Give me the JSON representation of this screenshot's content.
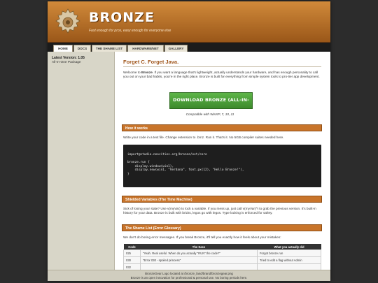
{
  "header": {
    "brand": "BRONZE",
    "tagline": "Fast enough for pros, easy enough for everyone else"
  },
  "nav": {
    "tabs": [
      {
        "label": "HOME",
        "active": true
      },
      {
        "label": "DOCS",
        "active": false
      },
      {
        "label": "THE SHAME LIST",
        "active": false
      },
      {
        "label": "HARDWARE/NET",
        "active": false
      },
      {
        "label": "GALLERY",
        "active": false
      }
    ]
  },
  "sidebar": {
    "title": "Latest Version: 1.05",
    "subtitle": "All-In-One Package"
  },
  "main": {
    "title": "Forget C. Forget Java.",
    "intro_pre": "Welcome to ",
    "intro_bold": "Bronze",
    "intro_post": ". If you want a language that's lightweight, actually understands your hardware, and has enough personality to call you out on your bad habits, you're in the right place. Bronze is built for everything from simple system tools to pro-tier app development.",
    "download_label": "DOWNLOAD BRONZE (ALL-IN-ONE)",
    "compat": "Compatible with WinXP, 7, 10, 11",
    "how": {
      "title": "How it works",
      "text": "Write your code in a text file. Change extension to .brnz. Run it. That's it. No 5GB compiler suites needed here.",
      "code": "import@studio.neocities.org/bronze/ext/core\n\nbronze.run {\n    display.window(win1),\n    display.new(win1, \"Verdana\", font.px(12), \"Hello Bronze!\"),\n}"
    },
    "shield": {
      "title": "Shielded Variables (The Time Machine)",
      "text": "Sick of losing your state? Use v(myVar) to lock a variable. If you mess up, just call v(myVar)^t to grab the previous version. It's built-in history for your data. Bronze is built with bricks, legos go with legos. Type locking is enforced for safety."
    },
    "shame": {
      "title": "The Shame List (Error Glossary)",
      "text": "We don't do boring error messages. If you break Bronze, it'll tell you exactly how it feels about your mistakes:",
      "columns": [
        "Code",
        "The Sass",
        "What you actually did"
      ],
      "rows": [
        [
          "025",
          "\"Yeah. Real useful. When do you actually \"RUN\" the code?\"",
          "Forgot bronze.run"
        ],
        [
          "030",
          "\"Error 030 - spoiled princess\"",
          "Tried to edit a flag without Admin"
        ],
        [
          "032",
          "",
          ""
        ]
      ]
    }
  },
  "footer": {
    "line1": "BronzeGear Logo located at /bronze_land/brand/bronzegear.png",
    "line2": "Bronze is an open innovation for professional & personal use. No boring periods here."
  },
  "colors": {
    "accent": "#c8742a",
    "download": "#4aa038",
    "header_start": "#d18a3a",
    "header_end": "#9a5719"
  }
}
